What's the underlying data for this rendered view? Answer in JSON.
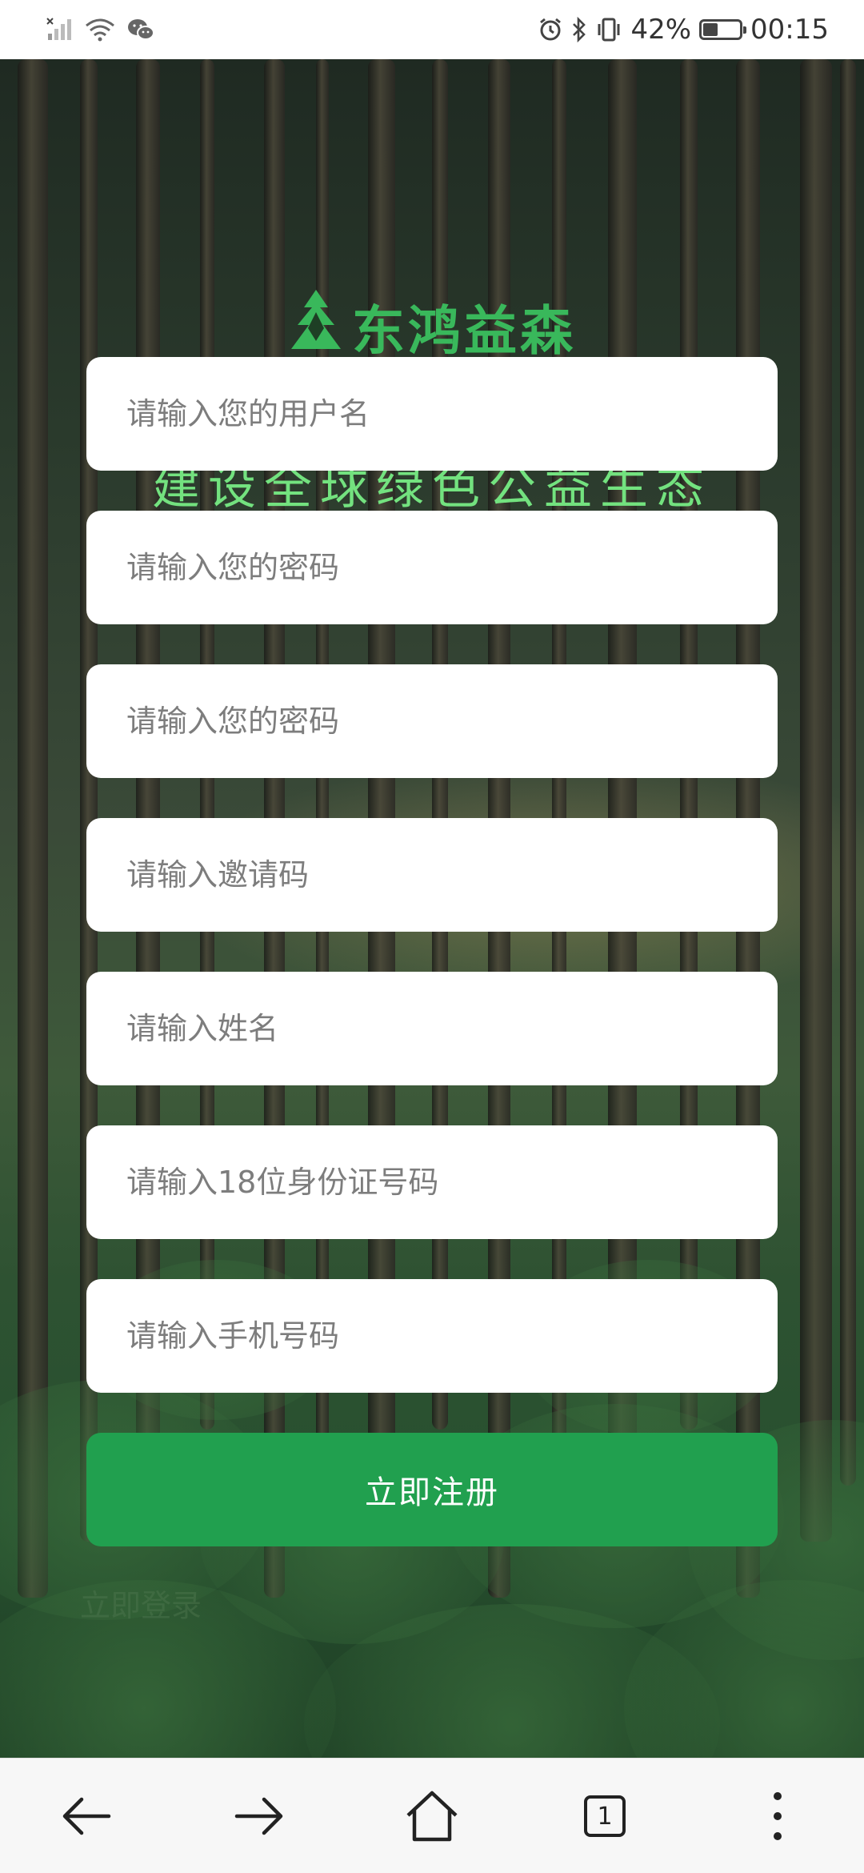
{
  "status_bar": {
    "battery_percent": "42%",
    "battery_level": 0.42,
    "time": "00:15",
    "icons": [
      "no-signal-icon",
      "wifi-icon",
      "wechat-icon",
      "alarm-icon",
      "bluetooth-icon",
      "vibrate-icon",
      "battery-icon"
    ]
  },
  "brand": {
    "name": "东鸿益森",
    "slogan": "建设全球绿色公益生态",
    "color": "#39b85b",
    "logo_icon": "leaf-logo-icon"
  },
  "form": {
    "username_placeholder": "请输入您的用户名",
    "password_placeholder": "请输入您的密码",
    "confirm_password_placeholder": "请输入您的密码",
    "invite_code_placeholder": "请输入邀请码",
    "name_placeholder": "请输入姓名",
    "id_number_placeholder": "请输入18位身份证号码",
    "phone_placeholder": "请输入手机号码",
    "submit_label": "立即注册",
    "submit_color": "#21a04f"
  },
  "faint_links": {
    "left": "立即登录",
    "right": ""
  },
  "bottom_nav": {
    "tab_count": "1",
    "icons": [
      "back-arrow-icon",
      "forward-arrow-icon",
      "home-icon",
      "tabs-icon",
      "more-menu-icon"
    ]
  }
}
